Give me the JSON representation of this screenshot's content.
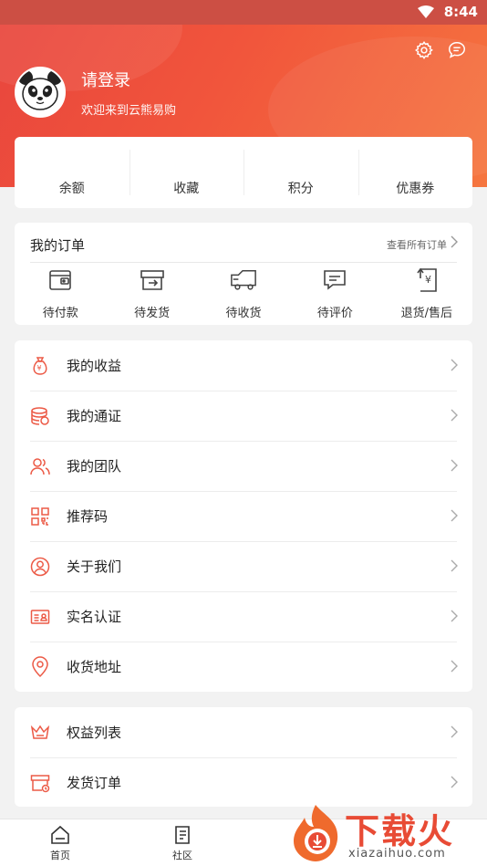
{
  "status": {
    "time": "8:44"
  },
  "profile": {
    "title": "请登录",
    "subtitle": "欢迎来到云熊易购"
  },
  "stats": [
    "余额",
    "收藏",
    "积分",
    "优惠券"
  ],
  "orders": {
    "title": "我的订单",
    "view_all": "查看所有订单",
    "items": [
      {
        "label": "待付款",
        "icon": "wallet-icon"
      },
      {
        "label": "待发货",
        "icon": "box-icon"
      },
      {
        "label": "待收货",
        "icon": "truck-icon"
      },
      {
        "label": "待评价",
        "icon": "comment-icon"
      },
      {
        "label": "退货/售后",
        "icon": "refund-icon"
      }
    ]
  },
  "menu1": [
    {
      "label": "我的收益",
      "icon": "money-bag-icon"
    },
    {
      "label": "我的通证",
      "icon": "coins-icon"
    },
    {
      "label": "我的团队",
      "icon": "team-icon"
    },
    {
      "label": "推荐码",
      "icon": "qrcode-icon"
    },
    {
      "label": "关于我们",
      "icon": "user-circle-icon"
    },
    {
      "label": "实名认证",
      "icon": "id-card-icon"
    },
    {
      "label": "收货地址",
      "icon": "location-icon"
    }
  ],
  "menu2": [
    {
      "label": "权益列表",
      "icon": "crown-icon"
    },
    {
      "label": "发货订单",
      "icon": "shipment-icon"
    }
  ],
  "tabs": [
    {
      "label": "首页",
      "icon": "home-icon"
    },
    {
      "label": "社区",
      "icon": "community-icon"
    }
  ],
  "watermark": {
    "brand": "下载火",
    "site": "xiazaihuo.com"
  },
  "colors": {
    "accent": "#ec5a46",
    "header_start": "#e8453d",
    "header_end": "#f5763f"
  }
}
